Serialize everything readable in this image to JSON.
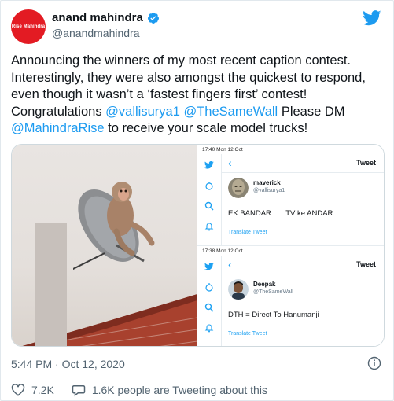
{
  "author": {
    "display_name": "anand mahindra",
    "handle": "@anandmahindra",
    "avatar_text": "Rise Mahindra"
  },
  "tweet": {
    "text_1": "Announcing the winners of my most recent caption contest. Interestingly, they were also amongst the quickest to respond, even though it wasn’t a ‘fastest fingers first’ contest! Congratulations ",
    "mention_1": "@vallisurya1",
    "space": " ",
    "mention_2": "@TheSameWall",
    "text_2": " Please DM ",
    "mention_3": "@MahindraRise",
    "text_3": " to receive your scale model trucks!"
  },
  "screenshot_1": {
    "status": "17:40   Mon 12 Oct",
    "header": "Tweet",
    "user": "maverick",
    "handle": "@vallisurya1",
    "text": "EK BANDAR...... TV ke ANDAR",
    "link": "Translate Tweet"
  },
  "screenshot_2": {
    "status": "17:38   Mon 12 Oct",
    "header": "Tweet",
    "user": "Deepak",
    "handle": "@TheSameWall",
    "text": "DTH = Direct To Hanumanji",
    "link": "Translate Tweet"
  },
  "footer": {
    "timestamp": "5:44 PM · Oct 12, 2020",
    "likes": "7.2K",
    "replies": "1.6K people are Tweeting about this"
  },
  "colors": {
    "accent": "#1d9bf0",
    "brand": "#e31b23",
    "muted": "#536471"
  }
}
